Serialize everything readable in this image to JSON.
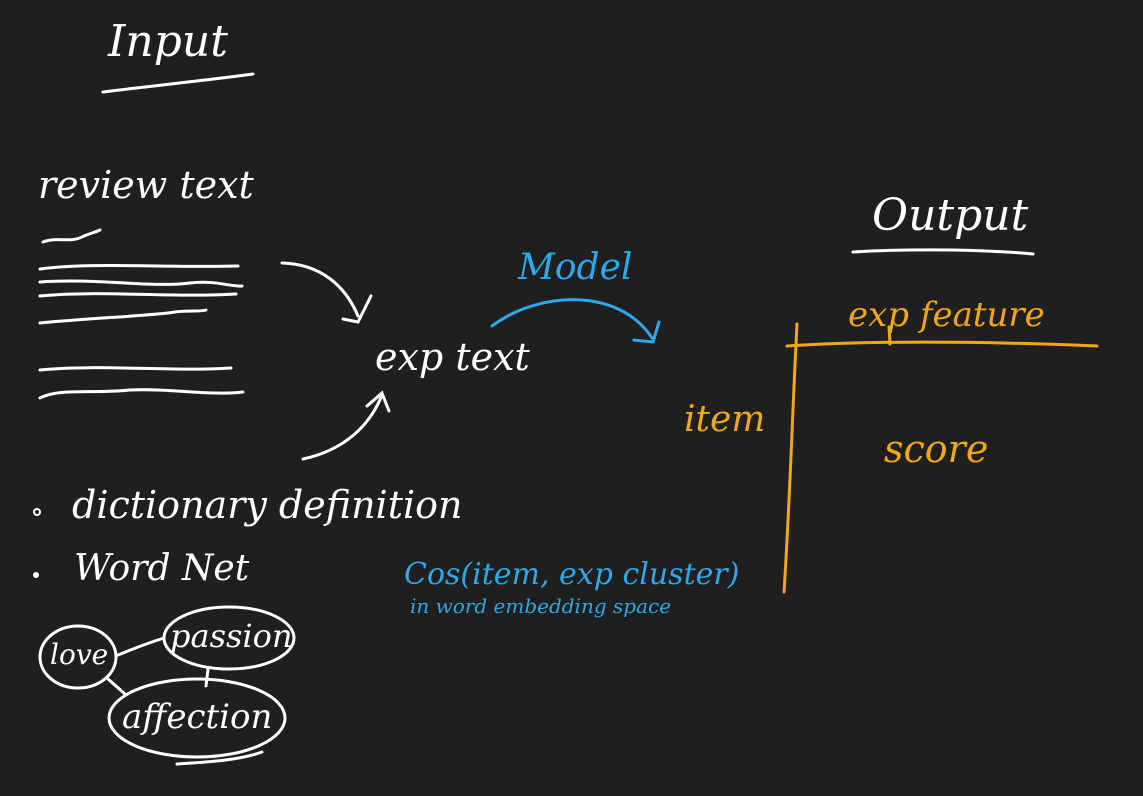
{
  "input": {
    "heading": "Input",
    "review_label": "review text",
    "bullets": [
      "dictionary definition",
      "Word Net"
    ],
    "graph_nodes": [
      "love",
      "passion",
      "affection"
    ]
  },
  "middle": {
    "exp_text": "exp text",
    "model_label": "Model",
    "cos_formula": "Cos(item, exp cluster)",
    "cos_note": "in word embedding space"
  },
  "output": {
    "heading": "Output",
    "column_header": "exp feature",
    "row_header": "item",
    "cell_value": "score"
  },
  "colors": {
    "background": "#1f1f1f",
    "ink": "#ffffff",
    "model": "#2fa8ea",
    "output": "#f0a81a"
  }
}
